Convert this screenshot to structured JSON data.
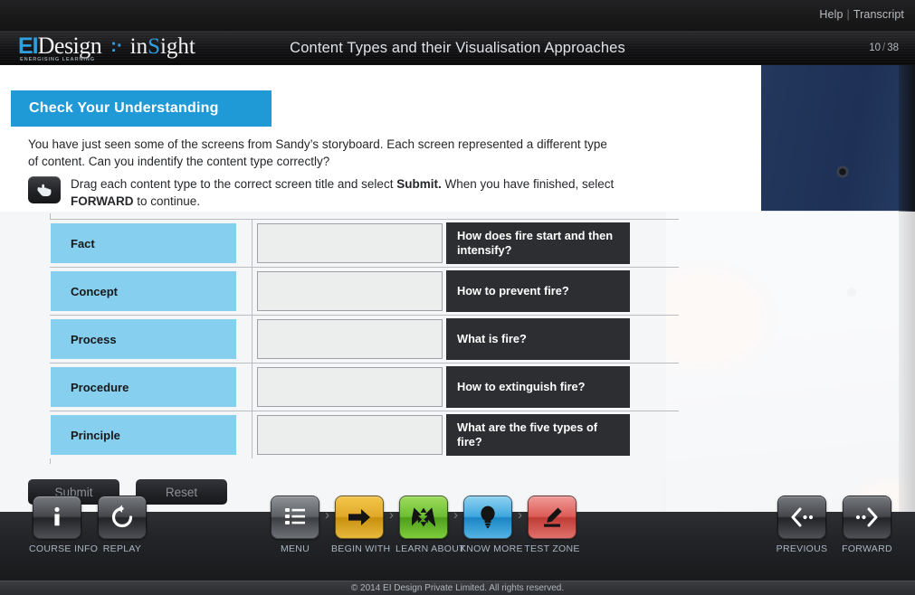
{
  "topbar": {
    "help_label": "Help",
    "separator": "|",
    "transcript_label": "Transcript"
  },
  "header": {
    "logo": {
      "ei": "EI",
      "design": "Design",
      "dots": ":·",
      "insight_in": "in",
      "insight_s": "S",
      "insight_ight": "ight",
      "tagline": "ENERGISING LEARNING"
    },
    "title": "Content Types and their Visualisation Approaches",
    "page_current": "10",
    "page_slash": "/",
    "page_total": "38"
  },
  "content": {
    "banner_label": "Check Your Understanding",
    "intro": "You have just seen some of the screens from Sandy’s storyboard. Each screen represented a different type of content. Can you indentify the content type correctly?",
    "drag_note_part1": "Drag each content type to the correct screen title and select ",
    "drag_note_bold1": "Submit.",
    "drag_note_part2": " When you have finished, select ",
    "drag_note_bold2": "FORWARD",
    "drag_note_part3": " to continue.",
    "hand_icon": "pointing-hand-icon"
  },
  "match_rows": [
    {
      "drag_label": "Fact",
      "drop_value": "",
      "title": "How does fire start and then intensify?"
    },
    {
      "drag_label": "Concept",
      "drop_value": "",
      "title": "How to prevent fire?"
    },
    {
      "drag_label": "Process",
      "drop_value": "",
      "title": "What is fire?"
    },
    {
      "drag_label": "Procedure",
      "drop_value": "",
      "title": "How to extinguish fire?"
    },
    {
      "drag_label": "Principle",
      "drop_value": "",
      "title": "What are the five types of fire?"
    }
  ],
  "actions": {
    "submit_label": "Submit",
    "reset_label": "Reset"
  },
  "toolbar": {
    "left": [
      {
        "label": "COURSE INFO",
        "icon": "info-icon",
        "style": "dark"
      },
      {
        "label": "REPLAY",
        "icon": "replay-icon",
        "style": "dark"
      }
    ],
    "center": [
      {
        "label": "MENU",
        "icon": "list-menu-icon",
        "style": "grey"
      },
      {
        "label": "BEGIN WITH",
        "icon": "right-arrow-icon",
        "style": "orange"
      },
      {
        "label": "LEARN ABOUT",
        "icon": "converge-arrows-icon",
        "style": "green"
      },
      {
        "label": "KNOW MORE",
        "icon": "lightbulb-icon",
        "style": "blue"
      },
      {
        "label": "TEST ZONE",
        "icon": "pencil-eraser-icon",
        "style": "red"
      }
    ],
    "separator": "›",
    "right": [
      {
        "label": "PREVIOUS",
        "icon": "previous-icon",
        "style": "dark"
      },
      {
        "label": "FORWARD",
        "icon": "forward-icon",
        "style": "dark"
      }
    ]
  },
  "footer": {
    "copyright": "© 2014 EI Design Private Limited. All rights reserved."
  },
  "colors": {
    "accent_blue": "#1f9ad6",
    "tile_blue": "#86cfee",
    "title_dark": "#2d2e31",
    "dropzone_grey": "#eceded"
  }
}
